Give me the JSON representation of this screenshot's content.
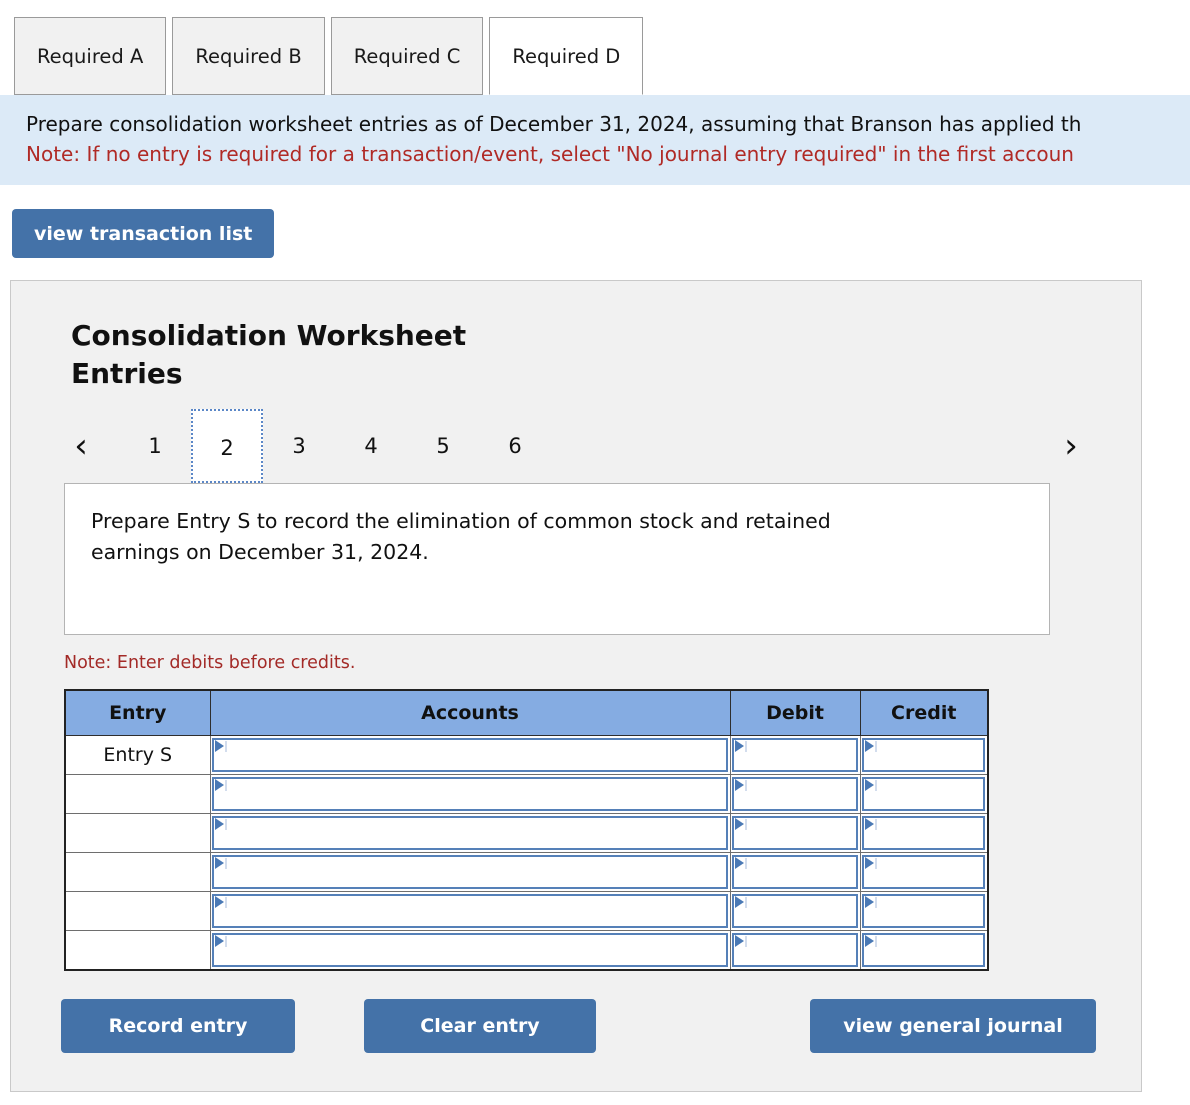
{
  "tabs": [
    {
      "label": "Required A",
      "active": false
    },
    {
      "label": "Required B",
      "active": false
    },
    {
      "label": "Required C",
      "active": false
    },
    {
      "label": "Required D",
      "active": true
    }
  ],
  "banner": {
    "instruction": "Prepare consolidation worksheet entries as of December 31, 2024, assuming that Branson has applied th",
    "note": "Note: If no entry is required for a transaction/event, select \"No journal entry required\" in the first accoun"
  },
  "toolbar": {
    "view_transaction_list": "view transaction list"
  },
  "card": {
    "title": "Consolidation Worksheet Entries",
    "pager": {
      "prev_icon": "‹",
      "next_icon": "›",
      "pages": [
        "1",
        "2",
        "3",
        "4",
        "5",
        "6"
      ],
      "current": "2"
    },
    "instruction": "Prepare Entry S to record the elimination of common stock and retained earnings on December 31, 2024.",
    "debit_note": "Note: Enter debits before credits.",
    "table": {
      "headers": {
        "entry": "Entry",
        "accounts": "Accounts",
        "debit": "Debit",
        "credit": "Credit"
      },
      "rows": [
        {
          "entry": "Entry S",
          "accounts": "",
          "debit": "",
          "credit": ""
        },
        {
          "entry": "",
          "accounts": "",
          "debit": "",
          "credit": ""
        },
        {
          "entry": "",
          "accounts": "",
          "debit": "",
          "credit": ""
        },
        {
          "entry": "",
          "accounts": "",
          "debit": "",
          "credit": ""
        },
        {
          "entry": "",
          "accounts": "",
          "debit": "",
          "credit": ""
        },
        {
          "entry": "",
          "accounts": "",
          "debit": "",
          "credit": ""
        }
      ]
    },
    "actions": {
      "record_entry": "Record entry",
      "clear_entry": "Clear entry",
      "view_general_journal": "view general journal"
    }
  },
  "colors": {
    "accent_blue": "#4472a8",
    "header_blue": "#85ace2",
    "banner_blue": "#dceaf7",
    "note_red": "#a32a27",
    "field_border": "#5580b8"
  }
}
